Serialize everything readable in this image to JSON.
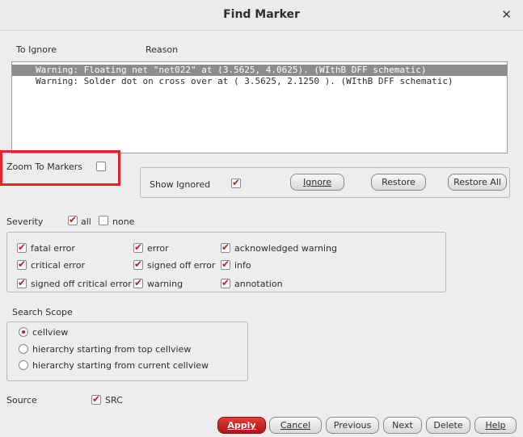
{
  "window": {
    "title": "Find Marker",
    "close_glyph": "✕"
  },
  "list": {
    "headers": {
      "to_ignore": "To Ignore",
      "reason": "Reason"
    },
    "rows": [
      {
        "text": "Warning: Floating net \"net022\" at (3.5625, 4.0625). (WIthB DFF schematic)",
        "selected": true
      },
      {
        "text": "Warning: Solder dot on cross over at ( 3.5625, 2.1250 ). (WIthB DFF schematic)",
        "selected": false
      }
    ]
  },
  "zoom": {
    "label": "Zoom To Markers",
    "checked": false
  },
  "ignore_panel": {
    "show_ignored_label": "Show Ignored",
    "show_ignored_checked": true,
    "ignore_button": "Ignore",
    "restore_button": "Restore",
    "restore_all_button": "Restore All"
  },
  "severity": {
    "label": "Severity",
    "all_label": "all",
    "all_checked": true,
    "none_label": "none",
    "none_checked": false,
    "items": [
      {
        "label": "fatal error",
        "checked": true
      },
      {
        "label": "critical error",
        "checked": true
      },
      {
        "label": "signed off critical error",
        "checked": true
      },
      {
        "label": "error",
        "checked": true
      },
      {
        "label": "signed off error",
        "checked": true
      },
      {
        "label": "warning",
        "checked": true
      },
      {
        "label": "acknowledged warning",
        "checked": true
      },
      {
        "label": "info",
        "checked": true
      },
      {
        "label": "annotation",
        "checked": true
      }
    ]
  },
  "scope": {
    "label": "Search Scope",
    "options": [
      {
        "label": "cellview",
        "selected": true
      },
      {
        "label": "hierarchy starting from top cellview",
        "selected": false
      },
      {
        "label": "hierarchy starting from current cellview",
        "selected": false
      }
    ]
  },
  "source": {
    "label": "Source",
    "src_label": "SRC",
    "src_checked": true
  },
  "buttons": {
    "apply": "Apply",
    "cancel": "Cancel",
    "previous": "Previous",
    "next": "Next",
    "delete": "Delete",
    "help": "Help"
  },
  "colors": {
    "accent": "#c41e1e",
    "highlight_outline": "#e8202a",
    "selection": "#8c8c8c"
  }
}
